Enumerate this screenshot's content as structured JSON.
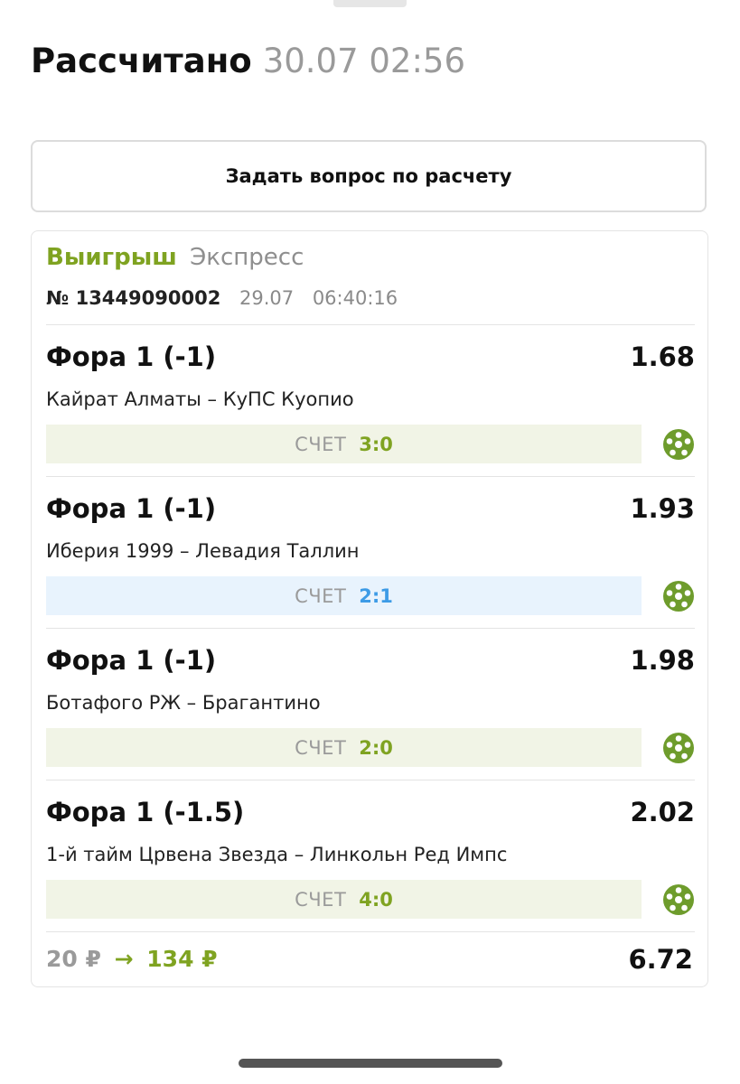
{
  "header": {
    "title": "Рассчитано",
    "datetime": "30.07 02:56"
  },
  "ask_button_label": "Задать вопрос по расчету",
  "ticket": {
    "status": "Выигрыш",
    "type": "Экспресс",
    "number": "№ 13449090002",
    "date": "29.07",
    "time": "06:40:16",
    "bets": [
      {
        "market": "Фора 1 (-1)",
        "odds": "1.68",
        "event": "Кайрат Алматы – КуПС Куопио",
        "score_label": "СЧЕТ",
        "score": "3:0",
        "score_bg": "#f1f4e6",
        "score_color": "#7fa321",
        "icon": "soccer-ball-icon"
      },
      {
        "market": "Фора 1 (-1)",
        "odds": "1.93",
        "event": "Иберия 1999 – Левадия Таллин",
        "score_label": "СЧЕТ",
        "score": "2:1",
        "score_bg": "#e8f3fd",
        "score_color": "#3d9be6",
        "icon": "soccer-ball-icon"
      },
      {
        "market": "Фора 1 (-1)",
        "odds": "1.98",
        "event": "Ботафого РЖ – Брагантино",
        "score_label": "СЧЕТ",
        "score": "2:0",
        "score_bg": "#f1f4e6",
        "score_color": "#7fa321",
        "icon": "soccer-ball-icon"
      },
      {
        "market": "Фора 1 (-1.5)",
        "odds": "2.02",
        "event": "1-й тайм Црвена Звезда – Линкольн Ред Импс",
        "score_label": "СЧЕТ",
        "score": "4:0",
        "score_bg": "#f1f4e6",
        "score_color": "#7fa321",
        "icon": "soccer-ball-icon"
      }
    ],
    "stake": "20 ₽",
    "arrow": "→",
    "payout": "134 ₽",
    "total_odds": "6.72"
  },
  "colors": {
    "win_green": "#7fa321",
    "icon_green": "#6e9c2c",
    "muted": "#9a9a9a"
  }
}
